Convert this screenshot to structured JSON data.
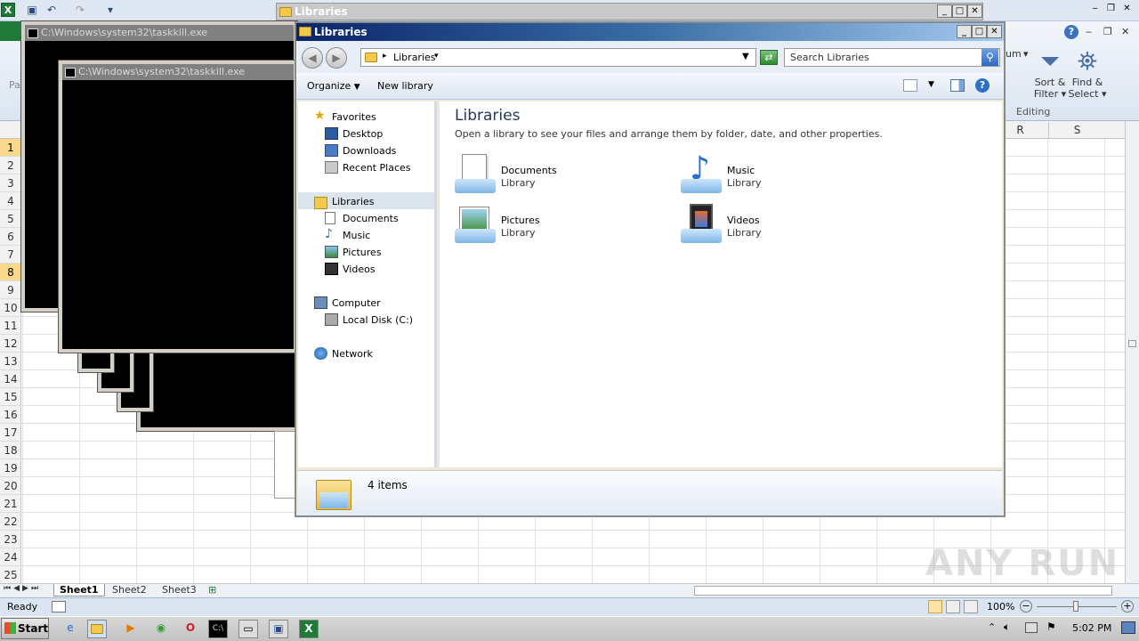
{
  "excel": {
    "ribbon_hint_left": "Pa",
    "ribbon_partial_text": "um",
    "sort_filter_line1": "Sort &",
    "sort_filter_line2": "Filter",
    "find_select_line1": "Find &",
    "find_select_line2": "Select",
    "editing_group": "Editing",
    "columns_visible": [
      "R",
      "S"
    ],
    "rows": [
      "1",
      "2",
      "3",
      "4",
      "5",
      "6",
      "7",
      "8",
      "9",
      "10",
      "11",
      "12",
      "13",
      "14",
      "15",
      "16",
      "17",
      "18",
      "19",
      "20",
      "21",
      "22",
      "23",
      "24",
      "25"
    ],
    "sheets": [
      "Sheet1",
      "Sheet2",
      "Sheet3"
    ],
    "status": "Ready",
    "zoom": "100%"
  },
  "cmd_windows": {
    "title": "C:\\Windows\\system32\\taskkill.exe"
  },
  "background_libraries": {
    "title": "Libraries"
  },
  "explorer": {
    "title": "Libraries",
    "breadcrumb": "Libraries",
    "search_placeholder": "Search Libraries",
    "toolbar": {
      "organize": "Organize",
      "new_library": "New library"
    },
    "nav": {
      "favorites": "Favorites",
      "desktop": "Desktop",
      "downloads": "Downloads",
      "recent_places": "Recent Places",
      "libraries": "Libraries",
      "documents": "Documents",
      "music": "Music",
      "pictures": "Pictures",
      "videos": "Videos",
      "computer": "Computer",
      "local_disk": "Local Disk (C:)",
      "network": "Network"
    },
    "main": {
      "heading": "Libraries",
      "description": "Open a library to see your files and arrange them by folder, date, and other properties.",
      "items": [
        {
          "name": "Documents",
          "sub": "Library"
        },
        {
          "name": "Music",
          "sub": "Library"
        },
        {
          "name": "Pictures",
          "sub": "Library"
        },
        {
          "name": "Videos",
          "sub": "Library"
        }
      ]
    },
    "details": {
      "count": "4 items"
    }
  },
  "taskbar": {
    "start": "Start",
    "clock": "5:02 PM"
  },
  "watermark": "ANY RUN"
}
